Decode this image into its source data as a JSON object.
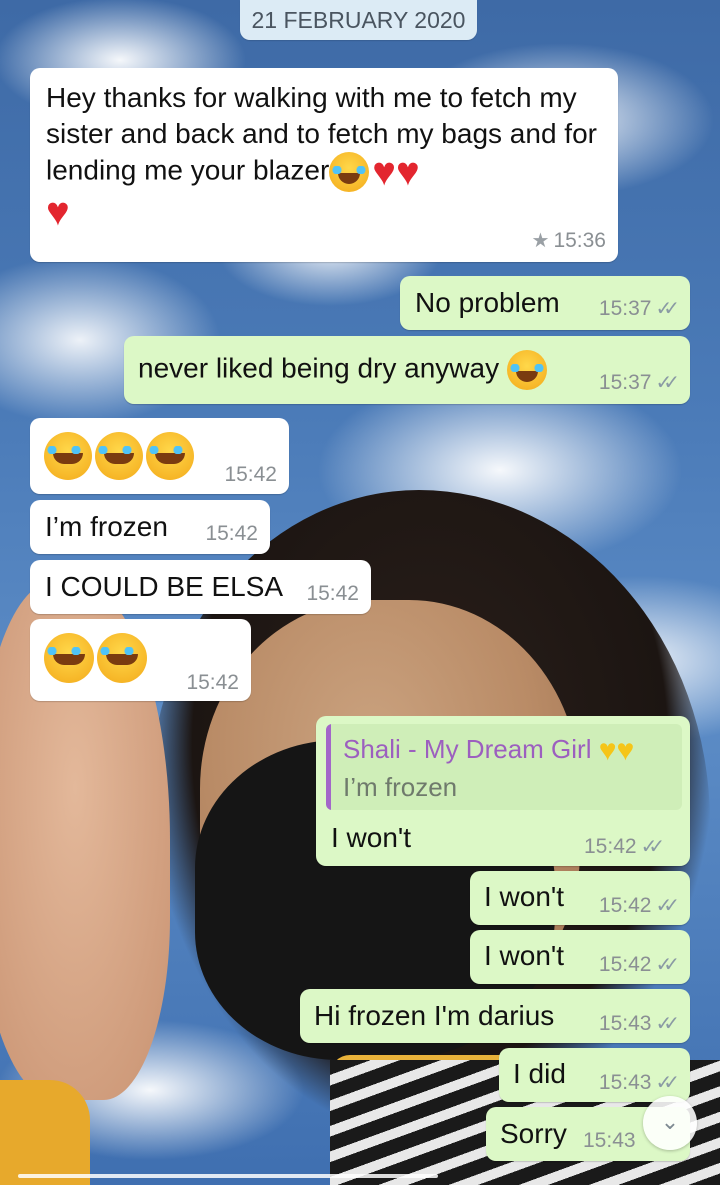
{
  "chat": {
    "date": "21 FEBRUARY 2020",
    "messages": [
      {
        "text": "Hey thanks for walking with me to fetch my sister and back and to fetch my bags and for lending me your blazer",
        "time": "15:36",
        "starred": true
      },
      {
        "text": "No problem",
        "time": "15:37"
      },
      {
        "text": "never liked being dry anyway",
        "time": "15:37"
      },
      {
        "text": "",
        "time": "15:42"
      },
      {
        "text": "I’m frozen",
        "time": "15:42"
      },
      {
        "text": "I COULD BE ELSA",
        "time": "15:42"
      },
      {
        "text": "",
        "time": "15:42"
      },
      {
        "text": "I won't",
        "time": "15:42",
        "quote": {
          "author": "Shali - My Dream Girl",
          "text": "I’m frozen"
        }
      },
      {
        "text": "I won't",
        "time": "15:42"
      },
      {
        "text": "I won't",
        "time": "15:42"
      },
      {
        "text": "Hi frozen I'm darius",
        "time": "15:43"
      },
      {
        "text": "I did",
        "time": "15:43"
      },
      {
        "text": "Sorry",
        "time": "15:43"
      }
    ]
  },
  "icons": {
    "read_receipt": "double-check-icon",
    "star": "star-icon",
    "scroll": "chevron-double-down-icon",
    "emoji": "face-with-tears-of-joy-emoji",
    "heart": "red-heart-emoji",
    "yellow_heart": "yellow-heart-emoji"
  },
  "colors": {
    "incoming_bubble": "#ffffff",
    "outgoing_bubble": "#dcf8c6",
    "quote_accent": "#a366c9"
  }
}
